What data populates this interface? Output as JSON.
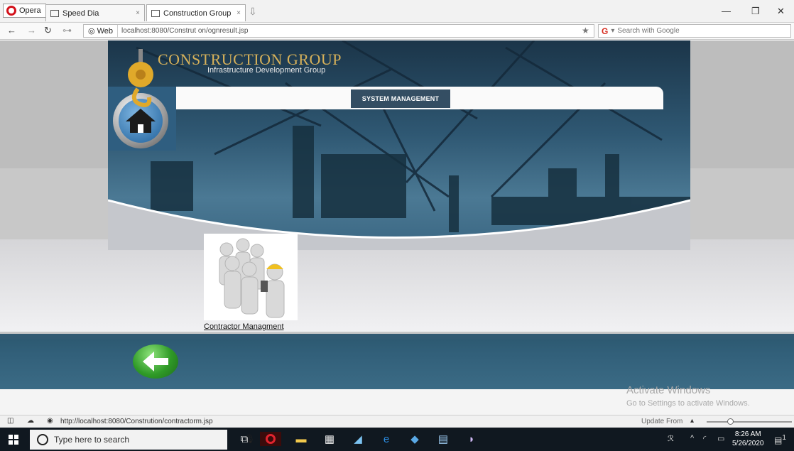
{
  "browser": {
    "opera_label": "Opera",
    "tabs": [
      {
        "label": "Speed Dia",
        "close": "×"
      },
      {
        "label": "Construction Group",
        "close": "×"
      }
    ],
    "new_tab": "⇩",
    "window": {
      "minimize": "—",
      "restore": "❐",
      "close": "✕"
    },
    "nav": {
      "back": "←",
      "forward": "→",
      "reload": "↻",
      "key": "⊶"
    },
    "web_label": "Web",
    "url": "localhost:8080/Construt on/ognresult.jsp",
    "star": "★",
    "search_placeholder": "Search with Google"
  },
  "site": {
    "title": "CONSTRUCTION GROUP",
    "subtitle": "Infrastructure Development Group",
    "nav_item": "SYSTEM MANAGEMENT",
    "contractor_link": "Contractor Managment"
  },
  "watermark": {
    "line1": "Activate Windows",
    "line2": "Go to Settings to activate Windows."
  },
  "statusbar": {
    "url": "http://localhost:8080/Constrution/contractorm.jsp",
    "update": "Update From",
    "zoom_level": 0.25
  },
  "taskbar": {
    "search_placeholder": "Type here to search",
    "time": "8:26 AM",
    "date": "5/26/2020",
    "notification_count": "1"
  },
  "colors": {
    "header_dark": "#1b3549",
    "nav_item_bg": "#344e63",
    "footer_band": "#32607a",
    "logo_gold": "#d6b15a",
    "back_green": "#2f9a27"
  }
}
